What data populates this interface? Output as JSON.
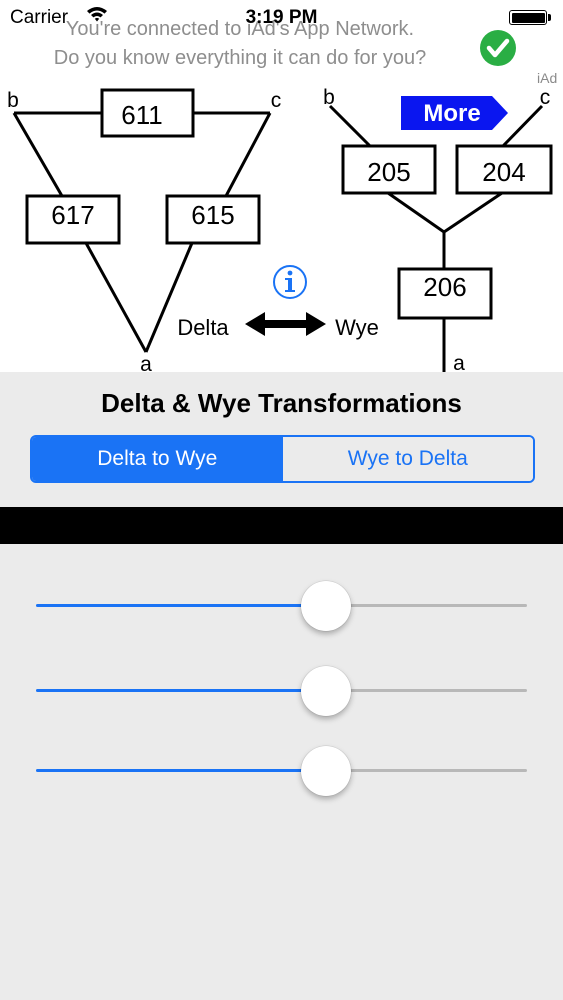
{
  "status_bar": {
    "carrier": "Carrier",
    "time": "3:19 PM"
  },
  "ad_banner": {
    "line1": "You're connected to iAd's App Network.",
    "line2": "Do you know everything it can do for you?",
    "tag": "iAd"
  },
  "diagram": {
    "delta": {
      "node_b": "b",
      "node_c": "c",
      "node_a": "a",
      "top_resistor": "611",
      "left_resistor": "617",
      "right_resistor": "615"
    },
    "wye": {
      "node_b": "b",
      "node_c": "c",
      "node_a": "a",
      "left_resistor": "205",
      "right_resistor": "204",
      "bottom_resistor": "206"
    },
    "more_label": "More",
    "delta_label": "Delta",
    "wye_label": "Wye"
  },
  "title": "Delta & Wye Transformations",
  "segments": [
    {
      "label": "Delta to Wye",
      "selected": true
    },
    {
      "label": "Wye to Delta",
      "selected": false
    }
  ],
  "sliders": [
    {
      "value": 0.6
    },
    {
      "value": 0.6
    },
    {
      "value": 0.6
    }
  ],
  "colors": {
    "accent": "#1a73f5",
    "more_button": "#0a16f0",
    "check_green": "#2aae44"
  }
}
